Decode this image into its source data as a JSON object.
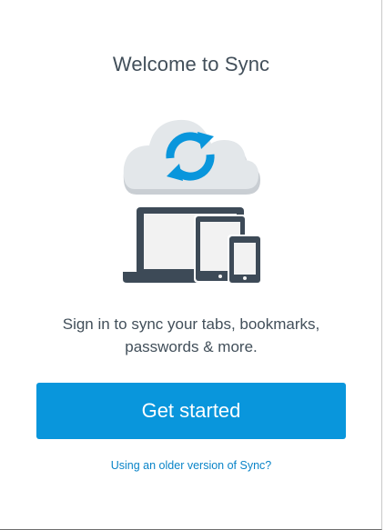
{
  "welcome": {
    "title": "Welcome to Sync",
    "tagline_line1": "Sign in to sync your tabs, bookmarks,",
    "tagline_line2": "passwords & more.",
    "get_started_label": "Get started",
    "older_version_link": "Using an older version of Sync?"
  },
  "icons": {
    "cloud": "sync-cloud-icon",
    "arrows": "sync-arrows-icon",
    "laptop": "laptop-icon",
    "tablet": "tablet-icon",
    "phone": "phone-icon"
  },
  "colors": {
    "accent": "#0996dc",
    "link": "#0a84c8",
    "text": "#424f5a",
    "device": "#3d4a57",
    "cloud": "#e3e7ea"
  }
}
